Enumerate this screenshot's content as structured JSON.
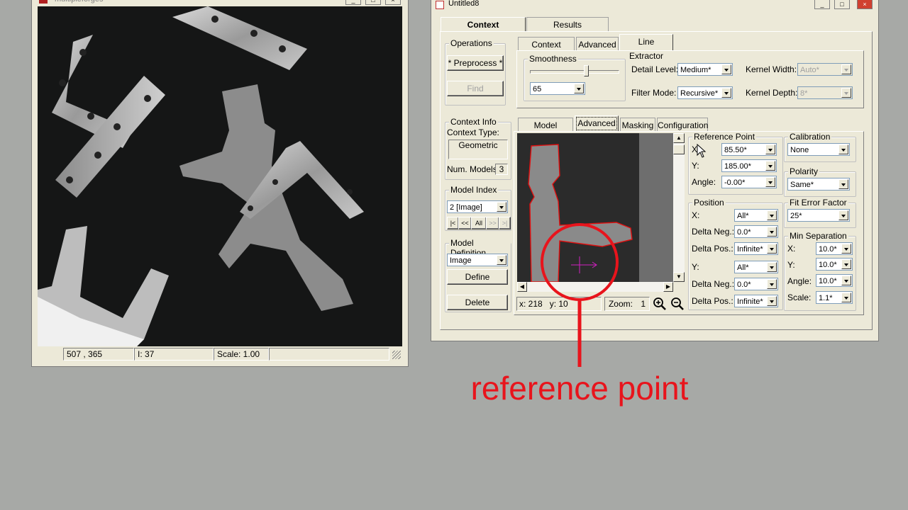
{
  "image_window": {
    "title": "multipleforges",
    "status": {
      "coords": "507 , 365",
      "intensity": "I: 37",
      "scale": "Scale: 1.00"
    }
  },
  "main_window": {
    "title": "Untitled8",
    "tabs": [
      "Context",
      "Results"
    ],
    "operations": {
      "label": "Operations",
      "preprocess": "* Preprocess *",
      "find": "Find"
    },
    "context_info": {
      "label": "Context Info",
      "type_label": "Context Type:",
      "type_value": "Geometric",
      "num_models_label": "Num. Models:",
      "num_models_value": "3"
    },
    "model_index": {
      "label": "Model Index",
      "value": "2 [Image]",
      "nav": [
        "|<",
        "<<",
        "All",
        ">>",
        ">|"
      ]
    },
    "model_definition": {
      "label": "Model Definition",
      "value": "Image",
      "define": "Define",
      "delete": "Delete"
    },
    "upper_tabs": [
      "Context Control",
      "Advanced",
      "Line Extractor"
    ],
    "smoothness": {
      "label": "Smoothness",
      "value": "65",
      "level": 0.65
    },
    "detail_level": {
      "label": "Detail Level:",
      "value": "Medium*"
    },
    "filter_mode": {
      "label": "Filter Mode:",
      "value": "Recursive*"
    },
    "kernel_width": {
      "label": "Kernel Width:",
      "value": "Auto*"
    },
    "kernel_depth": {
      "label": "Kernel Depth:",
      "value": "8*"
    },
    "lower_tabs": [
      "Model Controls",
      "Advanced",
      "Masking",
      "Configuration"
    ],
    "viewer": {
      "coords": "x: 218   y: 10",
      "zoom_label": "Zoom:",
      "zoom_value": "1"
    },
    "reference_point": {
      "label": "Reference Point",
      "x_label": "X:",
      "x": "85.50*",
      "y_label": "Y:",
      "y": "185.00*",
      "angle_label": "Angle:",
      "angle": "-0.00*"
    },
    "position": {
      "label": "Position",
      "x_label": "X:",
      "x": "All*",
      "dneg_label": "Delta Neg.:",
      "dneg_x": "0.0*",
      "dpos_label": "Delta Pos.:",
      "dpos_x": "Infinite*",
      "y_label": "Y:",
      "y": "All*",
      "dneg_y": "0.0*",
      "dpos_y": "Infinite*"
    },
    "calibration": {
      "label": "Calibration",
      "value": "None"
    },
    "polarity": {
      "label": "Polarity",
      "value": "Same*"
    },
    "fit_error": {
      "label": "Fit Error Factor",
      "value": "25*"
    },
    "min_separation": {
      "label": "Min Separation",
      "x_label": "X:",
      "x": "10.0*",
      "y_label": "Y:",
      "y": "10.0*",
      "angle_label": "Angle:",
      "angle": "10.0*",
      "scale_label": "Scale:",
      "scale": "1.1*"
    }
  },
  "annotation": {
    "text": "reference point",
    "color": "#e8141c"
  }
}
